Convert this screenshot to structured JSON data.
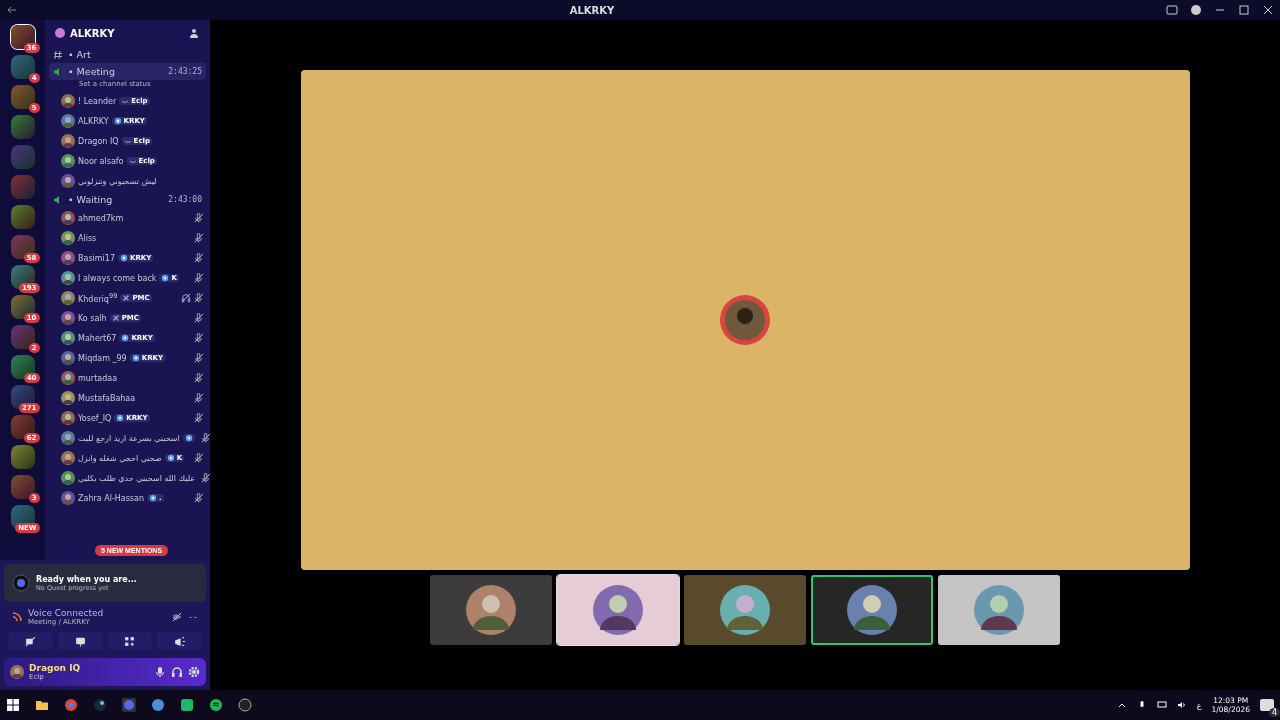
{
  "window": {
    "title": "ALKRKY"
  },
  "servers": [
    {
      "badge": "36",
      "active": true
    },
    {
      "badge": "4",
      "active": false
    },
    {
      "badge": "5",
      "active": false
    },
    {
      "active": false
    },
    {
      "active": false
    },
    {
      "active": false
    },
    {
      "active": false
    },
    {
      "badge": "58",
      "active": false
    },
    {
      "badge": "193",
      "active": false
    },
    {
      "badge": "10",
      "active": false
    },
    {
      "badge": "2",
      "active": false
    },
    {
      "badge": "40",
      "active": false
    },
    {
      "badge": "271",
      "active": false
    },
    {
      "badge": "62",
      "active": false
    },
    {
      "active": false
    },
    {
      "badge": "3",
      "active": false
    },
    {
      "badge": "NEW",
      "active": false
    }
  ],
  "server_name": "ALKRKY",
  "channels": [
    {
      "kind": "text",
      "name": "• Art"
    },
    {
      "kind": "voice",
      "name": "• Meeting",
      "timer": "2:43:25",
      "status": "Set a channel status",
      "users": [
        {
          "name": "! Leander",
          "tag": {
            "kind": "eclp",
            "label": "Eclp"
          },
          "muted": false,
          "deafened": false
        },
        {
          "name": "ALKRKY",
          "tag": {
            "kind": "krky",
            "label": "KRKY"
          },
          "muted": false,
          "deafened": false
        },
        {
          "name": "Dragon IQ",
          "tag": {
            "kind": "eclp",
            "label": "Eclp"
          },
          "muted": false,
          "deafened": false
        },
        {
          "name": "Noor alsafo",
          "tag": {
            "kind": "eclp",
            "label": "Eclp"
          },
          "muted": false,
          "deafened": false
        },
        {
          "name": "ليش تسحبوني وتنزلوني",
          "muted": false,
          "deafened": false
        }
      ]
    },
    {
      "kind": "voice",
      "name": "• Waiting",
      "timer": "2:43:00",
      "users": [
        {
          "name": "ahmed7km",
          "muted": true,
          "deafened": false
        },
        {
          "name": "Aliss",
          "muted": true,
          "deafened": false
        },
        {
          "name": "Basimi17",
          "tag": {
            "kind": "krky",
            "label": "KRKY"
          },
          "muted": true,
          "deafened": false
        },
        {
          "name": "I always come back",
          "tag": {
            "kind": "krky",
            "label": "K"
          },
          "muted": true,
          "deafened": false
        },
        {
          "name": "Khderiq$^{99}$",
          "tag": {
            "kind": "pmc",
            "label": "PMC"
          },
          "muted": true,
          "deafened": true
        },
        {
          "name": "Ko salh",
          "tag": {
            "kind": "pmc",
            "label": "PMC"
          },
          "muted": true,
          "deafened": false
        },
        {
          "name": "Mahert67",
          "tag": {
            "kind": "krky",
            "label": "KRKY"
          },
          "muted": true,
          "deafened": false
        },
        {
          "name": "Miqdam _99",
          "tag": {
            "kind": "krky",
            "label": "KRKY"
          },
          "muted": true,
          "deafened": false
        },
        {
          "name": "murtadaa",
          "muted": true,
          "deafened": false
        },
        {
          "name": "MustafaBahaa",
          "muted": true,
          "deafened": false
        },
        {
          "name": "Yosef_IQ",
          "tag": {
            "kind": "krky",
            "label": "KRKY"
          },
          "muted": true,
          "deafened": false
        },
        {
          "name": "اسحبني بسرعة اريد ارجع للبث",
          "tag": {
            "kind": "krky"
          },
          "muted": true,
          "deafened": false
        },
        {
          "name": "صحني احجي شغله وانزل",
          "tag": {
            "kind": "krky",
            "label": "K"
          },
          "muted": true,
          "deafened": false
        },
        {
          "name": "عليك الله اسحبني حدي طلب بكلبي",
          "muted": true,
          "deafened": false
        },
        {
          "name": "Zahra Al-Hassan",
          "tag": {
            "kind": "krky",
            "label": "."
          },
          "muted": true,
          "deafened": false
        }
      ]
    }
  ],
  "mentions": "5 NEW MENTIONS",
  "quest": {
    "title": "Ready when you are...",
    "subtitle": "No Quest progress yet"
  },
  "voice": {
    "status": "Voice Connected",
    "channel": "Meeting / ALKRKY"
  },
  "user": {
    "name": "Dragon IQ",
    "tag": "Eclp"
  },
  "stage": {
    "color": "#dcb468"
  },
  "participants": [
    {
      "color": "#3c3c3c",
      "selected": false,
      "speaking": false
    },
    {
      "color": "#e6ccd4",
      "selected": true,
      "speaking": false
    },
    {
      "color": "#5a4a2c",
      "selected": false,
      "speaking": false
    },
    {
      "color": "#262626",
      "selected": false,
      "speaking": true
    },
    {
      "color": "#c4c4c4",
      "selected": false,
      "speaking": false
    }
  ],
  "taskbar": {
    "language": "ع",
    "time": "12:03 PM",
    "date": "1/08/2026",
    "notifications": "4"
  }
}
